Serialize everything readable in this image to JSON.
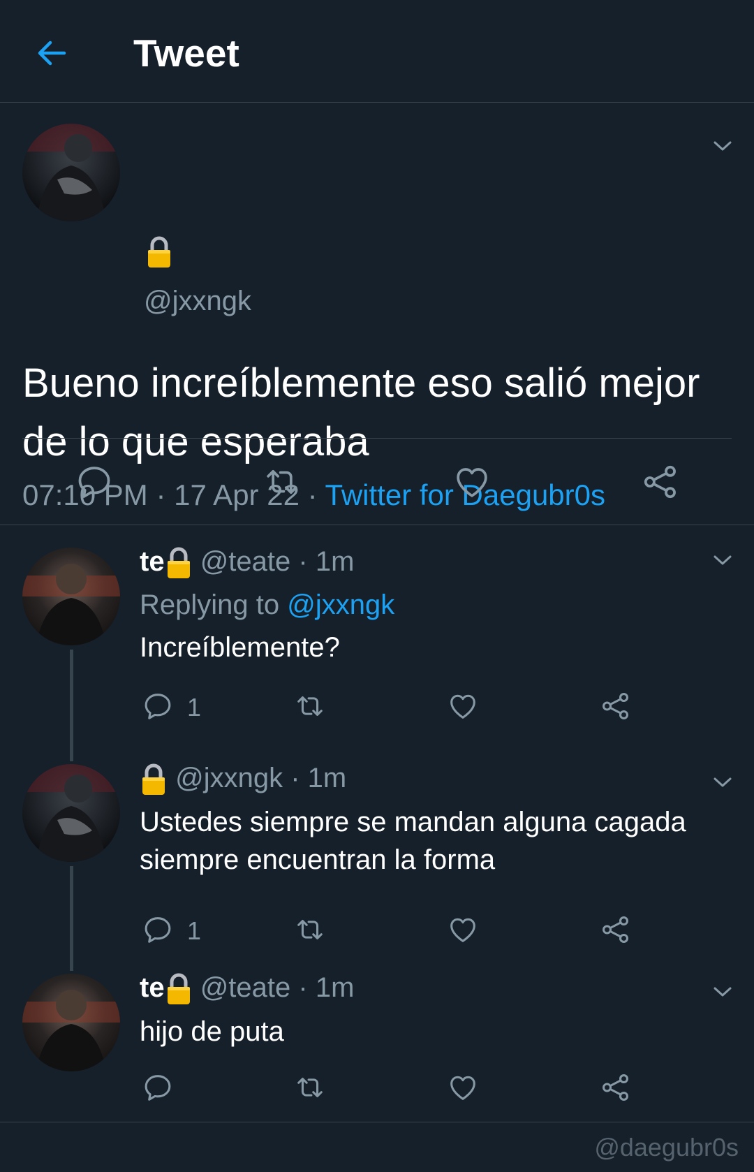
{
  "header": {
    "title": "Tweet"
  },
  "main_tweet": {
    "handle": "@jxxngk",
    "text": "Bueno increíblemente eso salió mejor de lo que esperaba",
    "time": "07:10 PM",
    "date": "17 Apr 22",
    "source": "Twitter for Daegubr0s",
    "sep": " · "
  },
  "replies": [
    {
      "name": "te",
      "handle": "@teate",
      "time": "1m",
      "replying_label": "Replying to",
      "replying_to": "@jxxngk",
      "text": "Increíblemente?",
      "reply_count": "1"
    },
    {
      "name": "",
      "handle": "@jxxngk",
      "time": "1m",
      "text": "Ustedes siempre se mandan alguna cagada siempre encuentran la forma",
      "reply_count": "1"
    },
    {
      "name": "te",
      "handle": "@teate",
      "time": "1m",
      "text": "hijo de puta",
      "reply_count": ""
    }
  ],
  "watermark": "@daegubr0s",
  "colors": {
    "background": "#15202b",
    "accent": "#1da1f2",
    "muted": "#8899a6",
    "divider": "#38444d",
    "lock": "#f5b800"
  },
  "icons": [
    "back-arrow-icon",
    "lock-icon",
    "chevron-down-icon",
    "reply-icon",
    "retweet-icon",
    "like-icon",
    "share-icon"
  ]
}
